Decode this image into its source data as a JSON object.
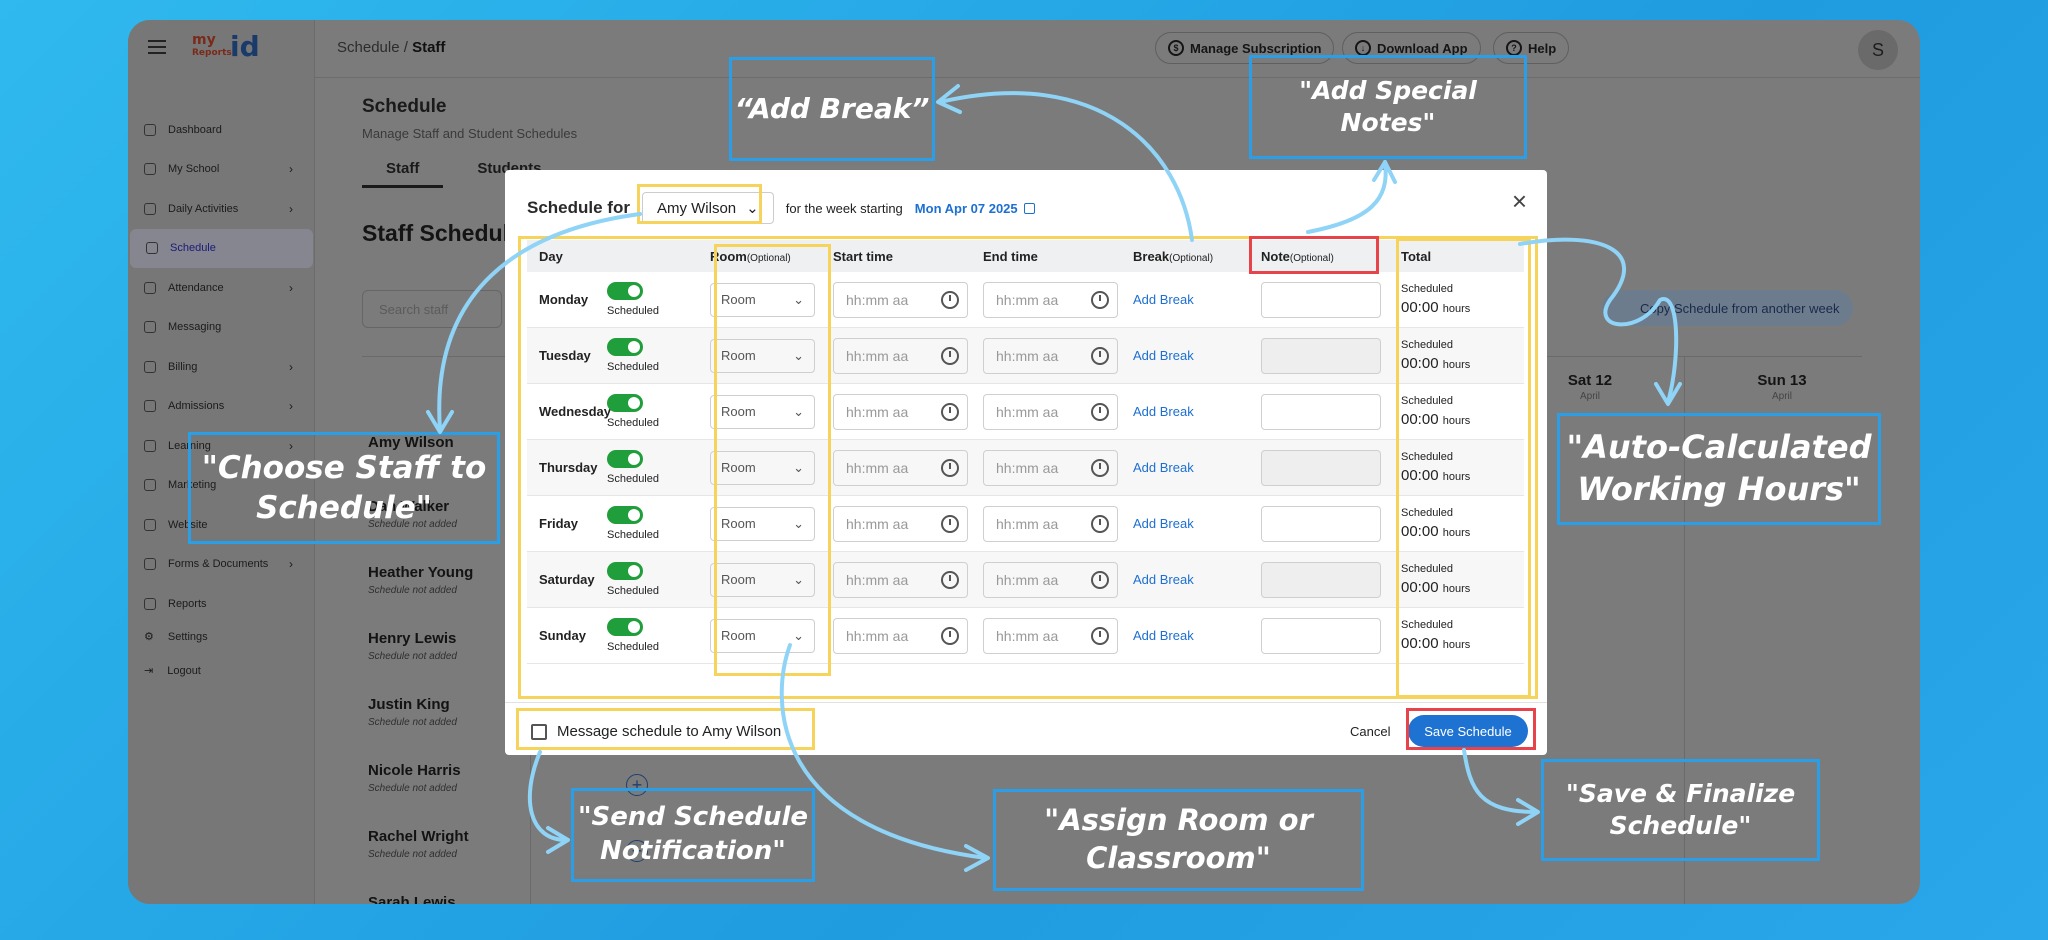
{
  "app": {
    "logo": {
      "my": "my",
      "reports": "Reports",
      "kid": "Kid"
    },
    "breadcrumb": {
      "parent": "Schedule",
      "separator": "/",
      "current": "Staff"
    },
    "top_buttons": [
      {
        "label": "Manage Subscription",
        "icon": "subscription-icon"
      },
      {
        "label": "Download App",
        "icon": "download-icon"
      },
      {
        "label": "Help",
        "icon": "help-icon"
      }
    ],
    "avatar_letter": "S",
    "sidebar": {
      "items": [
        {
          "label": "Dashboard",
          "chevron": false
        },
        {
          "label": "My School",
          "chevron": true
        },
        {
          "label": "Daily Activities",
          "chevron": true
        },
        {
          "label": "Schedule",
          "chevron": false,
          "active": true
        },
        {
          "label": "Attendance",
          "chevron": true
        },
        {
          "label": "Messaging",
          "chevron": false
        },
        {
          "label": "Billing",
          "chevron": true
        },
        {
          "label": "Admissions",
          "chevron": true
        },
        {
          "label": "Learning",
          "chevron": true
        },
        {
          "label": "Marketing",
          "chevron": false
        },
        {
          "label": "Website",
          "chevron": false
        },
        {
          "label": "Forms & Documents",
          "chevron": true
        },
        {
          "label": "Reports",
          "chevron": false
        }
      ],
      "settings": "Settings",
      "logout": "Logout"
    },
    "page": {
      "title": "Schedule",
      "subtitle": "Manage Staff and Student Schedules",
      "tabs": [
        "Staff",
        "Students"
      ],
      "section_title": "Staff Schedule",
      "search_placeholder": "Search staff",
      "copy_button": "Copy Schedule from another week",
      "days": [
        {
          "day": "Sat 12",
          "month": "April"
        },
        {
          "day": "Sun 13",
          "month": "April"
        }
      ],
      "staff": [
        {
          "name": "Amy Wilson",
          "note": ""
        },
        {
          "name": "Dan Walker",
          "note": "Schedule not added"
        },
        {
          "name": "Heather Young",
          "note": "Schedule not added"
        },
        {
          "name": "Henry Lewis",
          "note": "Schedule not added"
        },
        {
          "name": "Justin King",
          "note": "Schedule not added"
        },
        {
          "name": "Nicole Harris",
          "note": "Schedule not added"
        },
        {
          "name": "Rachel Wright",
          "note": "Schedule not added"
        },
        {
          "name": "Sarah Lewis",
          "note": ""
        }
      ]
    }
  },
  "modal": {
    "schedule_for_label": "Schedule for",
    "staff_selected": "Amy Wilson",
    "week_label": "for the week starting",
    "week_date": "Mon Apr 07 2025",
    "columns": {
      "day": "Day",
      "room": "Room",
      "room_hint": "(Optional)",
      "start": "Start time",
      "end": "End time",
      "break": "Break",
      "break_hint": "(Optional)",
      "note": "Note",
      "note_hint": "(Optional)",
      "total": "Total"
    },
    "rows": [
      {
        "day": "Monday",
        "status": "Scheduled",
        "room": "Room",
        "start": "hh:mm aa",
        "end": "hh:mm aa",
        "break": "Add Break",
        "total_label": "Scheduled",
        "total_value": "00:00",
        "total_unit": "hours"
      },
      {
        "day": "Tuesday",
        "status": "Scheduled",
        "room": "Room",
        "start": "hh:mm aa",
        "end": "hh:mm aa",
        "break": "Add Break",
        "total_label": "Scheduled",
        "total_value": "00:00",
        "total_unit": "hours"
      },
      {
        "day": "Wednesday",
        "status": "Scheduled",
        "room": "Room",
        "start": "hh:mm aa",
        "end": "hh:mm aa",
        "break": "Add Break",
        "total_label": "Scheduled",
        "total_value": "00:00",
        "total_unit": "hours"
      },
      {
        "day": "Thursday",
        "status": "Scheduled",
        "room": "Room",
        "start": "hh:mm aa",
        "end": "hh:mm aa",
        "break": "Add Break",
        "total_label": "Scheduled",
        "total_value": "00:00",
        "total_unit": "hours"
      },
      {
        "day": "Friday",
        "status": "Scheduled",
        "room": "Room",
        "start": "hh:mm aa",
        "end": "hh:mm aa",
        "break": "Add Break",
        "total_label": "Scheduled",
        "total_value": "00:00",
        "total_unit": "hours"
      },
      {
        "day": "Saturday",
        "status": "Scheduled",
        "room": "Room",
        "start": "hh:mm aa",
        "end": "hh:mm aa",
        "break": "Add Break",
        "total_label": "Scheduled",
        "total_value": "00:00",
        "total_unit": "hours"
      },
      {
        "day": "Sunday",
        "status": "Scheduled",
        "room": "Room",
        "start": "hh:mm aa",
        "end": "hh:mm aa",
        "break": "Add Break",
        "total_label": "Scheduled",
        "total_value": "00:00",
        "total_unit": "hours"
      }
    ],
    "message_checkbox": "Message schedule to Amy Wilson",
    "cancel": "Cancel",
    "save": "Save Schedule"
  },
  "callouts": {
    "add_break": "“Add Break”",
    "special_notes": "\"Add Special Notes\"",
    "choose_staff": "\"Choose Staff to Schedule\"",
    "auto_hours": "\"Auto-Calculated Working Hours\"",
    "send_notification": "\"Send Schedule Notification\"",
    "assign_room": "\"Assign Room or Classroom\"",
    "save_finalize": "\"Save & Finalize Schedule\""
  },
  "colors": {
    "background": "#22a8ea",
    "callout_border": "#2a9ee6",
    "highlight_yellow": "#f6d35b",
    "highlight_red": "#e6444a",
    "arrow": "#8fd3f7",
    "accent_blue": "#1e73d2",
    "toggle_green": "#1f9e3b"
  }
}
